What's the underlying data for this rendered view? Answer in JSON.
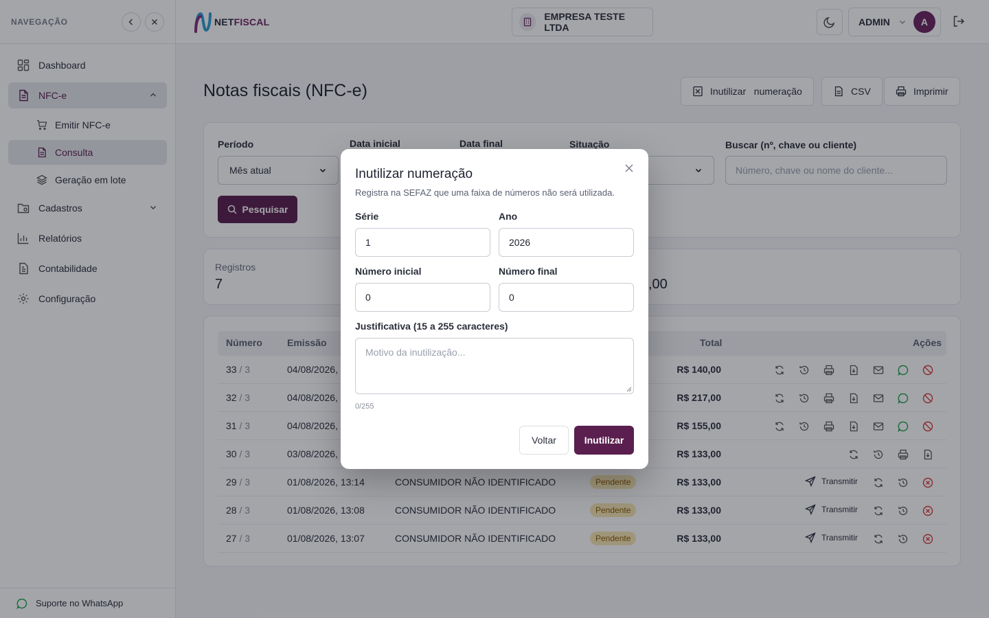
{
  "sidebar": {
    "title": "NAVEGAÇÃO",
    "items": [
      {
        "label": "Dashboard",
        "icon": "dashboard-icon"
      },
      {
        "label": "NFC-e",
        "icon": "document-icon"
      },
      {
        "label": "Cadastros",
        "icon": "folder-icon"
      },
      {
        "label": "Relatórios",
        "icon": "bar-chart-icon"
      },
      {
        "label": "Contabilidade",
        "icon": "file-icon"
      },
      {
        "label": "Configuração",
        "icon": "gear-icon"
      }
    ],
    "subitems": [
      {
        "label": "Emitir NFC-e",
        "icon": "cart-icon"
      },
      {
        "label": "Consulta",
        "icon": "document-icon"
      },
      {
        "label": "Geração em lote",
        "icon": "layers-icon"
      }
    ],
    "footer": "Suporte no WhatsApp"
  },
  "topbar": {
    "logo_a": "NET",
    "logo_b": "FISCAL",
    "company": "EMPRESA TESTE LTDA",
    "user": "ADMIN",
    "avatar_letter": "A"
  },
  "page": {
    "title": "Notas fiscais (NFC-e)",
    "btn_inutilizar": "Inutilizar   numeração",
    "btn_csv": "CSV",
    "btn_imprimir": "Imprimir"
  },
  "filters": {
    "periodo_label": "Período",
    "periodo_value": "Mês atual",
    "data_inicial_label": "Data inicial",
    "data_final_label": "Data final",
    "situacao_label": "Situação",
    "buscar_label": "Buscar (nº, chave ou cliente)",
    "buscar_placeholder": "Número, chave ou nome do cliente...",
    "search_button": "Pesquisar"
  },
  "stats": {
    "registros_label": "Registros",
    "registros_value": "7",
    "total_partial": ",00"
  },
  "table": {
    "headers": {
      "numero": "Número",
      "emissao": "Emissão",
      "total": "Total",
      "acoes": "Ações"
    },
    "rows": [
      {
        "num": "33",
        "serie": "/ 3",
        "emissao": "04/08/2026,",
        "cliente": "",
        "status": "",
        "total": "R$ 140,00"
      },
      {
        "num": "32",
        "serie": "/ 3",
        "emissao": "04/08/2026,",
        "cliente": "",
        "status": "",
        "total": "R$ 217,00"
      },
      {
        "num": "31",
        "serie": "/ 3",
        "emissao": "04/08/2026,",
        "cliente": "",
        "status": "",
        "total": "R$ 155,00"
      },
      {
        "num": "30",
        "serie": "/ 3",
        "emissao": "03/08/2026,",
        "cliente": "",
        "status": "",
        "total": "R$ 133,00"
      },
      {
        "num": "29",
        "serie": "/ 3",
        "emissao": "01/08/2026, 13:14",
        "cliente": "CONSUMIDOR NÃO IDENTIFICADO",
        "status": "Pendente",
        "total": "R$ 133,00"
      },
      {
        "num": "28",
        "serie": "/ 3",
        "emissao": "01/08/2026, 13:08",
        "cliente": "CONSUMIDOR NÃO IDENTIFICADO",
        "status": "Pendente",
        "total": "R$ 133,00"
      },
      {
        "num": "27",
        "serie": "/ 3",
        "emissao": "01/08/2026, 13:07",
        "cliente": "CONSUMIDOR NÃO IDENTIFICADO",
        "status": "Pendente",
        "total": "R$ 133,00"
      }
    ],
    "transmit_label": "Transmitir"
  },
  "modal": {
    "title": "Inutilizar numeração",
    "subtitle": "Registra na SEFAZ que uma faixa de números não será utilizada.",
    "serie_label": "Série",
    "serie_value": "1",
    "ano_label": "Ano",
    "ano_value": "2026",
    "num_inicial_label": "Número inicial",
    "num_inicial_value": "0",
    "num_final_label": "Número final",
    "num_final_value": "0",
    "justificativa_label": "Justificativa (15 a 255 caracteres)",
    "justificativa_placeholder": "Motivo da inutilização...",
    "counter": "0/255",
    "back_button": "Voltar",
    "confirm_button": "Inutilizar"
  },
  "colors": {
    "brand": "#5a1f4f",
    "pending_bg": "#f7e7b4",
    "whatsapp": "#1ba24b",
    "cancel": "#d63b3b"
  }
}
